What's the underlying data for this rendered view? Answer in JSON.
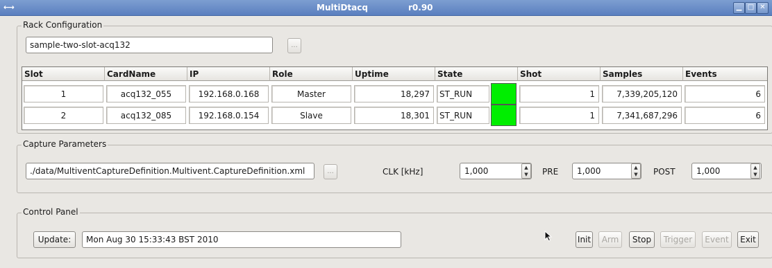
{
  "window": {
    "icon": "⟷",
    "title": "MultiDtacq",
    "version": "r0.90"
  },
  "rack": {
    "legend": "Rack Configuration",
    "config_value": "sample-two-slot-acq132",
    "browse_label": "...",
    "table": {
      "headers": [
        "Slot",
        "CardName",
        "IP",
        "Role",
        "Uptime",
        "State",
        "Shot",
        "Samples",
        "Events"
      ],
      "rows": [
        [
          "1",
          "acq132_055",
          "192.168.0.168",
          "Master",
          "18,297",
          "ST_RUN",
          "1",
          "7,339,205,120",
          "6"
        ],
        [
          "2",
          "acq132_085",
          "192.168.0.154",
          "Slave",
          "18,301",
          "ST_RUN",
          "1",
          "7,341,687,296",
          "6"
        ]
      ],
      "state_color": "#00ee00"
    }
  },
  "capture": {
    "legend": "Capture Parameters",
    "file_value": "./data/MultiventCaptureDefinition.Multivent.CaptureDefinition.xml",
    "browse_label": "...",
    "clk_label": "CLK [kHz]",
    "clk_value": "1,000",
    "pre_label": "PRE",
    "pre_value": "1,000",
    "post_label": "POST",
    "post_value": "1,000"
  },
  "control": {
    "legend": "Control Panel",
    "update_label": "Update:",
    "timestamp": "Mon Aug 30 15:33:43 BST 2010",
    "buttons": {
      "init": "Init",
      "arm": "Arm",
      "stop": "Stop",
      "trigger": "Trigger",
      "event": "Event",
      "exit": "Exit"
    }
  }
}
